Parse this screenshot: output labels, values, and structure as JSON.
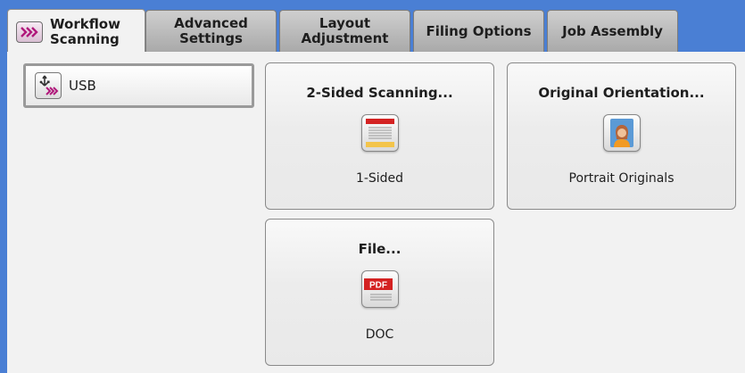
{
  "tabs": [
    {
      "label": "Workflow\nScanning",
      "active": true,
      "icon": "workflow-scan-icon"
    },
    {
      "label": "Advanced\nSettings",
      "active": false
    },
    {
      "label": "Layout\nAdjustment",
      "active": false
    },
    {
      "label": "Filing Options",
      "active": false
    },
    {
      "label": "Job Assembly",
      "active": false
    }
  ],
  "destination": {
    "label": "USB",
    "icon": "usb-icon"
  },
  "cards": {
    "two_sided": {
      "title": "2-Sided Scanning...",
      "value": "1-Sided",
      "icon": "one-sided-page-icon"
    },
    "orientation": {
      "title": "Original Orientation...",
      "value": "Portrait Originals",
      "icon": "portrait-person-icon"
    },
    "file": {
      "title": "File...",
      "value": "DOC",
      "icon": "pdf-document-icon",
      "icon_text": "PDF"
    }
  },
  "colors": {
    "accent_blue": "#4a7fd4",
    "pdf_red": "#d42222",
    "scan_magenta": "#b0197b"
  }
}
